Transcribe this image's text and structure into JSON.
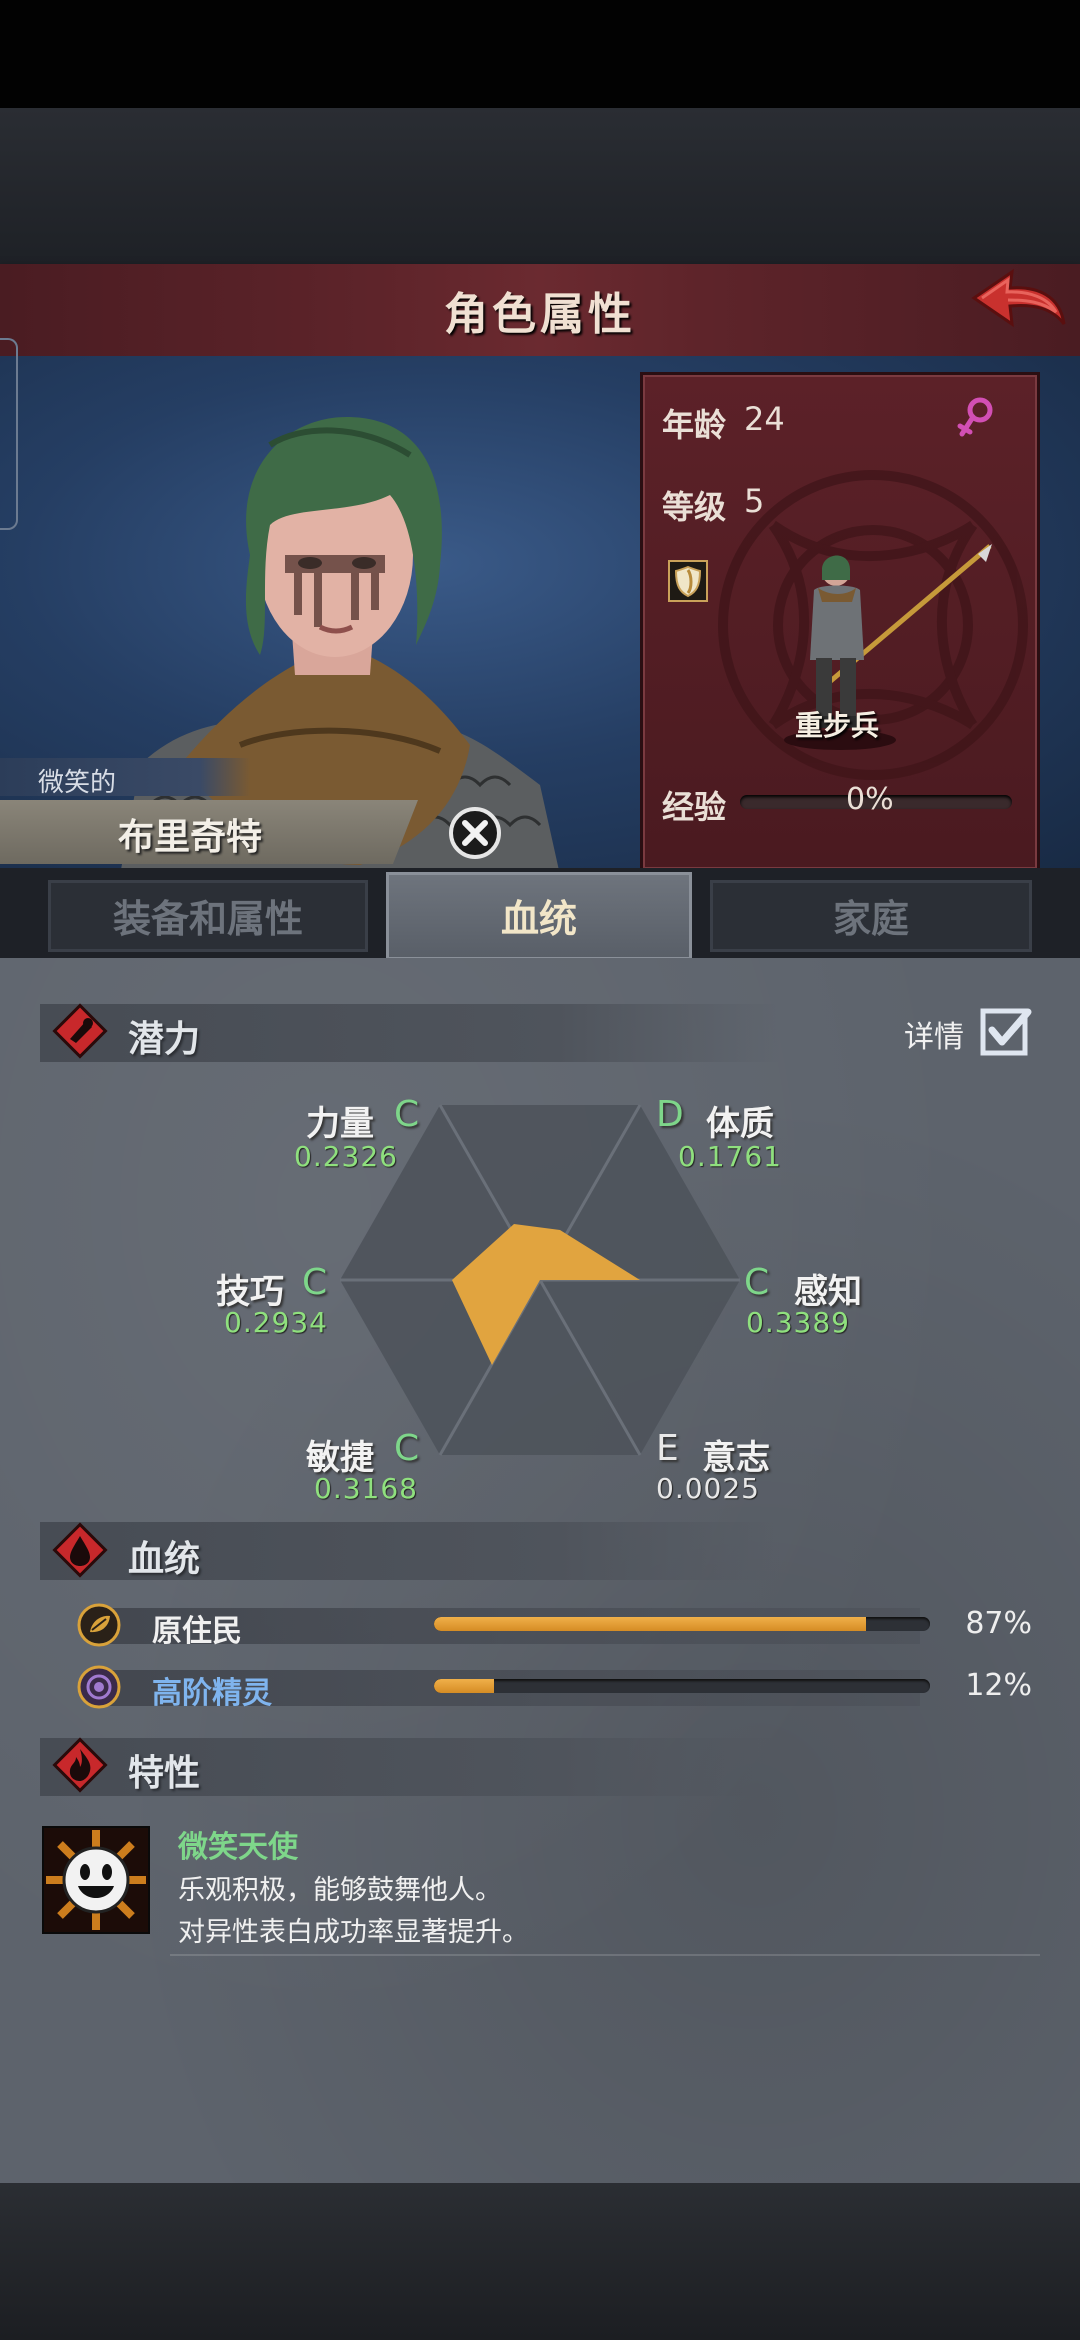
{
  "header": {
    "title": "角色属性"
  },
  "character": {
    "epithet": "微笑的",
    "name": "布里奇特",
    "age_label": "年龄",
    "age": "24",
    "level_label": "等级",
    "level": "5",
    "class_name": "重步兵",
    "exp_label": "经验",
    "exp_percent": "0%"
  },
  "tabs": [
    {
      "label": "装备和属性",
      "active": false
    },
    {
      "label": "血统",
      "active": true
    },
    {
      "label": "家庭",
      "active": false
    }
  ],
  "potential": {
    "title": "潜力",
    "details_label": "详情",
    "details_checked": true,
    "stats": [
      {
        "name": "力量",
        "grade": "C",
        "value": "0.2326"
      },
      {
        "name": "体质",
        "grade": "D",
        "value": "0.1761"
      },
      {
        "name": "技巧",
        "grade": "C",
        "value": "0.2934"
      },
      {
        "name": "感知",
        "grade": "C",
        "value": "0.3389"
      },
      {
        "name": "敏捷",
        "grade": "C",
        "value": "0.3168"
      },
      {
        "name": "意志",
        "grade": "E",
        "value": "0.0025"
      }
    ]
  },
  "bloodline": {
    "title": "血统",
    "items": [
      {
        "name": "原住民",
        "percent": "87%",
        "fill": 0.87,
        "color": "#f0f0f0",
        "icon": "leaf-icon"
      },
      {
        "name": "高阶精灵",
        "percent": "12%",
        "fill": 0.12,
        "color": "#7fb4ee",
        "icon": "elf-eye-icon"
      }
    ]
  },
  "traits": {
    "title": "特性",
    "items": [
      {
        "name": "微笑天使",
        "desc1": "乐观积极，能够鼓舞他人。",
        "desc2": "对异性表白成功率显著提升。",
        "icon": "smile-face-icon"
      }
    ]
  },
  "colors": {
    "banner": "#5e242a",
    "card": "#4f1b21",
    "radar_fill": "#e1a43f",
    "grade": "#7ed68a",
    "bar_fill": "#e8a43a"
  }
}
